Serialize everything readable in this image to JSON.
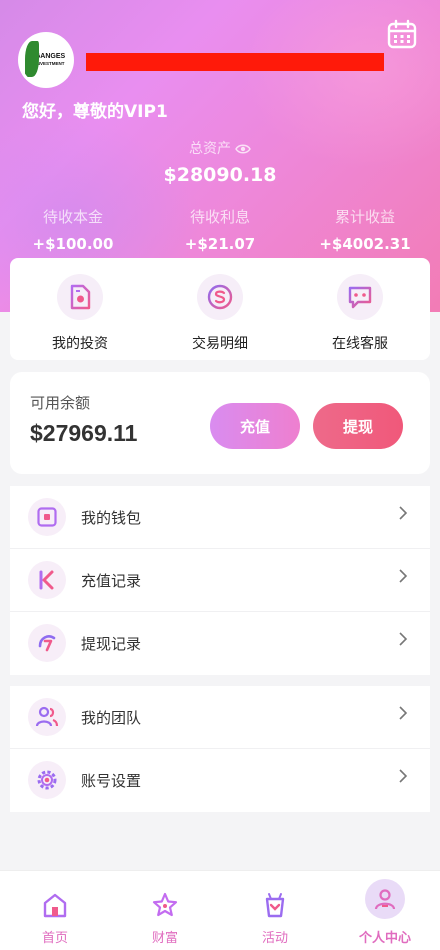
{
  "profile": {
    "avatar_brand_line1": "GANGES",
    "avatar_brand_line2": "INVESTMENT",
    "greeting": "您好，尊敬的VIP1"
  },
  "assets": {
    "total_label": "总资产",
    "total_value": "$28090.18",
    "stats": [
      {
        "label": "待收本金",
        "value": "+$100.00"
      },
      {
        "label": "待收利息",
        "value": "+$21.07"
      },
      {
        "label": "累计收益",
        "value": "+$4002.31"
      }
    ]
  },
  "quick_actions": [
    {
      "label": "我的投资",
      "icon": "investment-doc-icon"
    },
    {
      "label": "交易明细",
      "icon": "transaction-icon"
    },
    {
      "label": "在线客服",
      "icon": "chat-service-icon"
    }
  ],
  "balance": {
    "label": "可用余额",
    "value": "$27969.11",
    "recharge_label": "充值",
    "withdraw_label": "提现"
  },
  "menu_group1": [
    {
      "label": "我的钱包",
      "icon": "wallet-icon"
    },
    {
      "label": "充值记录",
      "icon": "recharge-record-icon"
    },
    {
      "label": "提现记录",
      "icon": "withdraw-record-icon"
    }
  ],
  "menu_group2": [
    {
      "label": "我的团队",
      "icon": "team-icon"
    },
    {
      "label": "账号设置",
      "icon": "settings-gear-icon"
    }
  ],
  "tabbar": [
    {
      "label": "首页",
      "icon": "home-icon"
    },
    {
      "label": "财富",
      "icon": "star-icon"
    },
    {
      "label": "活动",
      "icon": "gift-bag-icon"
    },
    {
      "label": "个人中心",
      "icon": "user-icon",
      "active": true
    }
  ],
  "colors": {
    "accent_pink": "#e06cbf",
    "header_start": "#d58ae8",
    "header_end": "#f27cb5",
    "withdraw_red": "#f0587a",
    "redaction": "#ff1a0a"
  }
}
